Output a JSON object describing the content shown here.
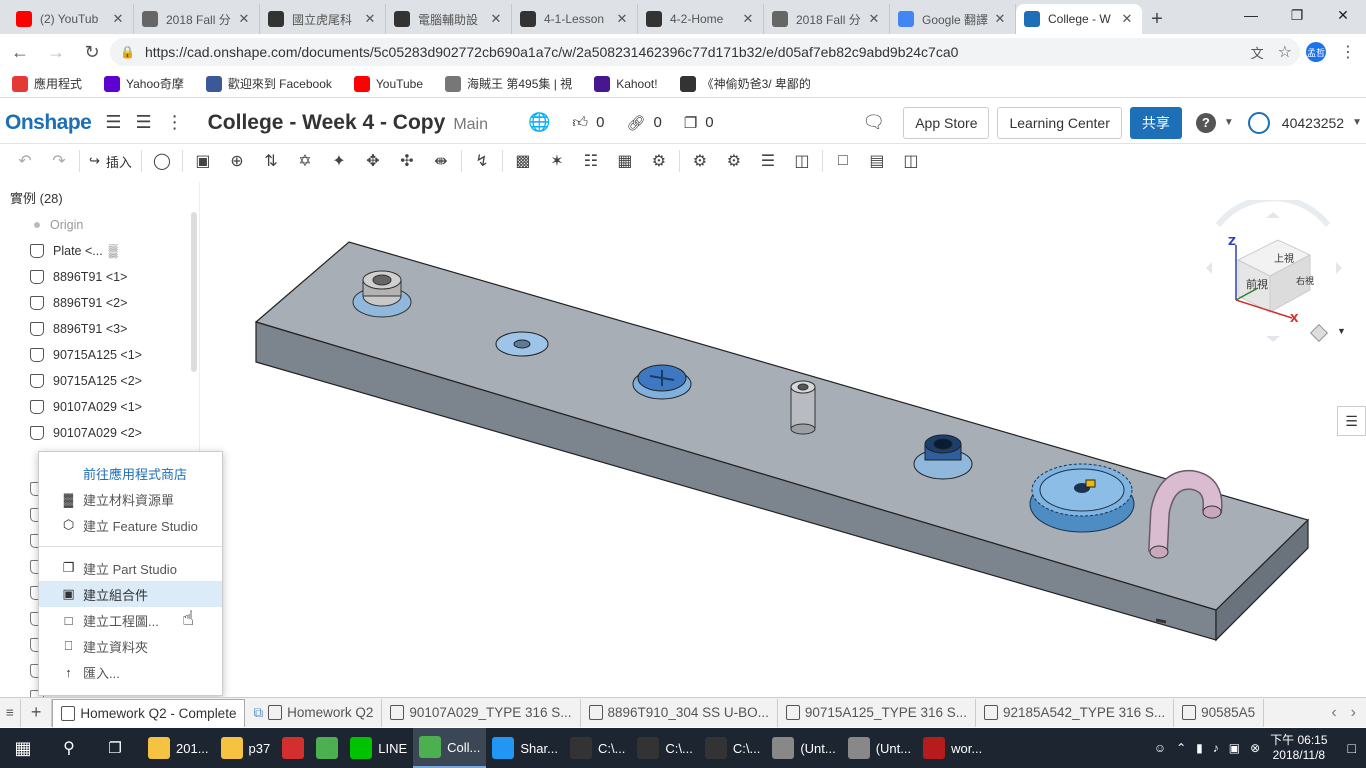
{
  "browser": {
    "tabs": [
      {
        "title": "(2) YouTub",
        "icon": "youtube-icon",
        "color": "#ff0000"
      },
      {
        "title": "2018 Fall 分",
        "icon": "doc-icon",
        "color": "#666666"
      },
      {
        "title": "國立虎尾科",
        "icon": "wolf-icon",
        "color": "#333333"
      },
      {
        "title": "電腦輔助設",
        "icon": "wolf-icon",
        "color": "#333333"
      },
      {
        "title": "4-1-Lesson",
        "icon": "wolf-icon",
        "color": "#333333"
      },
      {
        "title": "4-2-Home",
        "icon": "wolf-icon",
        "color": "#333333"
      },
      {
        "title": "2018 Fall 分",
        "icon": "doc-icon",
        "color": "#666666"
      },
      {
        "title": "Google 翻譯",
        "icon": "google-translate-icon",
        "color": "#4285f4"
      },
      {
        "title": "College - W",
        "icon": "onshape-icon",
        "color": "#1d6fb8"
      }
    ],
    "url": "https://cad.onshape.com/documents/5c05283d902772cb690a1a7c/w/2a508231462396c77d171b32/e/d05af7eb82c9abd9b24c7ca0",
    "profile_initials": "孟哲",
    "bookmarks": [
      {
        "label": "應用程式",
        "icon": "apps-grid-icon",
        "color": "#e53935"
      },
      {
        "label": "Yahoo奇摩",
        "icon": "yahoo-icon",
        "color": "#5f01d1"
      },
      {
        "label": "歡迎來到 Facebook",
        "icon": "facebook-icon",
        "color": "#3b5998"
      },
      {
        "label": "YouTube",
        "icon": "youtube-icon",
        "color": "#ff0000"
      },
      {
        "label": "海賊王 第495集 | 視",
        "icon": "doc-icon",
        "color": "#777777"
      },
      {
        "label": "Kahoot!",
        "icon": "kahoot-icon",
        "color": "#46178f"
      },
      {
        "label": "《神偷奶爸3/ 卑鄙的",
        "icon": "film-icon",
        "color": "#333333"
      }
    ]
  },
  "onshape": {
    "logo": "Onshape",
    "document_title": "College - Week 4 - Copy",
    "branch": "Main",
    "likes": "0",
    "links": "0",
    "copies": "0",
    "app_store": "App Store",
    "learning_center": "Learning Center",
    "share": "共享",
    "user": "40423252",
    "insert_label": "插入",
    "brand_color": "#1d6fb8"
  },
  "instances": {
    "header": "實例 (28)",
    "items": [
      {
        "label": "Origin",
        "type": "origin"
      },
      {
        "label": "Plate <...",
        "type": "part"
      },
      {
        "label": "8896T91 <1>",
        "type": "part"
      },
      {
        "label": "8896T91 <2>",
        "type": "part"
      },
      {
        "label": "8896T91 <3>",
        "type": "part"
      },
      {
        "label": "90715A125 <1>",
        "type": "part"
      },
      {
        "label": "90715A125 <2>",
        "type": "part"
      },
      {
        "label": "90107A029 <1>",
        "type": "part"
      },
      {
        "label": "90107A029 <2>",
        "type": "part"
      }
    ]
  },
  "context_menu": {
    "goto_store": "前往應用程式商店",
    "items_a": [
      {
        "label": "建立材料資源單",
        "icon": "bom-icon"
      },
      {
        "label": "建立 Feature Studio",
        "icon": "feature-studio-icon"
      }
    ],
    "items_b": [
      {
        "label": "建立 Part Studio",
        "icon": "part-studio-icon"
      },
      {
        "label": "建立組合件",
        "icon": "assembly-icon"
      },
      {
        "label": "建立工程圖...",
        "icon": "drawing-icon"
      },
      {
        "label": "建立資料夾",
        "icon": "folder-icon"
      },
      {
        "label": "匯入...",
        "icon": "import-icon"
      }
    ]
  },
  "viewcube": {
    "top": "上視",
    "front": "前視",
    "right": "右視",
    "axis_z": "Z",
    "axis_x": "X"
  },
  "bottom_tabs": [
    {
      "label": "Homework Q2 - Complete",
      "active": true
    },
    {
      "label": "Homework Q2",
      "active": false
    },
    {
      "label": "90107A029_TYPE 316 S...",
      "active": false
    },
    {
      "label": "8896T910_304 SS U-BO...",
      "active": false
    },
    {
      "label": "90715A125_TYPE 316 S...",
      "active": false
    },
    {
      "label": "92185A542_TYPE 316 S...",
      "active": false
    },
    {
      "label": "90585A5",
      "active": false
    }
  ],
  "taskbar": {
    "apps": [
      {
        "label": "201...",
        "icon": "folder-icon",
        "color": "#f5c242",
        "active": false
      },
      {
        "label": "p37",
        "icon": "folder-icon",
        "color": "#f5c242",
        "active": false
      },
      {
        "label": "",
        "icon": "pdf-icon",
        "color": "#d32f2f",
        "active": false
      },
      {
        "label": "",
        "icon": "chrome-icon",
        "color": "#4caf50",
        "active": false
      },
      {
        "label": "LINE",
        "icon": "line-icon",
        "color": "#00c300",
        "active": false
      },
      {
        "label": "Coll...",
        "icon": "chrome-icon",
        "color": "#4caf50",
        "active": true
      },
      {
        "label": "Shar...",
        "icon": "sharex-icon",
        "color": "#2196f3",
        "active": false
      },
      {
        "label": "C:\\...",
        "icon": "cmd-icon",
        "color": "#333333",
        "active": false
      },
      {
        "label": "C:\\...",
        "icon": "cmd-icon",
        "color": "#333333",
        "active": false
      },
      {
        "label": "C:\\...",
        "icon": "cmd-icon",
        "color": "#333333",
        "active": false
      },
      {
        "label": "(Unt...",
        "icon": "sphere-icon",
        "color": "#888888",
        "active": false
      },
      {
        "label": "(Unt...",
        "icon": "sphere-icon",
        "color": "#888888",
        "active": false
      },
      {
        "label": "wor...",
        "icon": "image-icon",
        "color": "#b71c1c",
        "active": false
      }
    ],
    "time": "下午 06:15",
    "date": "2018/11/8"
  }
}
